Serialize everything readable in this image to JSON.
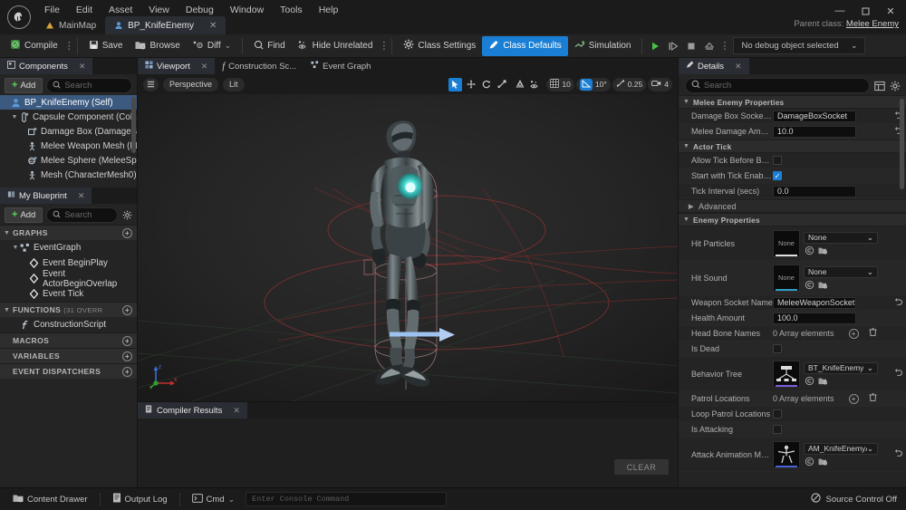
{
  "window": {
    "logo": "unreal-logo",
    "menus": [
      "File",
      "Edit",
      "Asset",
      "View",
      "Debug",
      "Window",
      "Tools",
      "Help"
    ],
    "controls": {
      "minimize": "—",
      "maximize": "❐",
      "close": "✕"
    },
    "parent_class_label": "Parent class:",
    "parent_class_value": "Melee Enemy"
  },
  "document_tabs": [
    {
      "label": "MainMap",
      "icon": "level-icon",
      "active": false,
      "closeable": false
    },
    {
      "label": "BP_KnifeEnemy",
      "icon": "blueprint-icon",
      "active": true,
      "closeable": true,
      "close": "✕"
    }
  ],
  "toolbar": {
    "compile": "Compile",
    "save": "Save",
    "browse": "Browse",
    "diff": "Diff",
    "find": "Find",
    "hide_unrelated": "Hide Unrelated",
    "class_settings": "Class Settings",
    "class_defaults": "Class Defaults",
    "simulation": "Simulation",
    "dots": "⋮",
    "chevron": "⌄",
    "play": "▶",
    "step": "⏯",
    "stop": "■",
    "eject": "⏏",
    "debug_object": "No debug object selected",
    "accent_color": "#1a7fd4"
  },
  "components_panel": {
    "tab": "Components",
    "tab_close": "✕",
    "add_label": "Add",
    "search_placeholder": "Search",
    "items": [
      {
        "label": "BP_KnifeEnemy (Self)",
        "indent": 0,
        "selected": true,
        "arrow": "",
        "icon": "actor-icon"
      },
      {
        "label": "Capsule Component (Collisi",
        "indent": 1,
        "selected": false,
        "arrow": "▼",
        "icon": "capsule-icon"
      },
      {
        "label": "Damage Box (DamageBox",
        "indent": 2,
        "selected": false,
        "arrow": "",
        "icon": "box-icon"
      },
      {
        "label": "Melee Weapon Mesh (Mel",
        "indent": 2,
        "selected": false,
        "arrow": "",
        "icon": "mesh-icon"
      },
      {
        "label": "Melee Sphere (MeleeSphe",
        "indent": 2,
        "selected": false,
        "arrow": "",
        "icon": "sphere-icon"
      },
      {
        "label": "Mesh (CharacterMesh0)",
        "indent": 2,
        "selected": false,
        "arrow": "",
        "icon": "mesh-icon"
      }
    ]
  },
  "my_blueprint_panel": {
    "tab": "My Blueprint",
    "tab_close": "✕",
    "add_label": "Add",
    "search_placeholder": "Search",
    "settings_icon": "gear-icon",
    "sections": [
      {
        "title": "GRAPHS",
        "suffix": "",
        "arrow": "▼",
        "plus": "+",
        "items": [
          {
            "label": "EventGraph",
            "indent": 1,
            "arrow": "▼",
            "icon": "graph-icon"
          },
          {
            "label": "Event BeginPlay",
            "indent": 2,
            "arrow": "",
            "icon": "event-node-icon"
          },
          {
            "label": "Event ActorBeginOverlap",
            "indent": 2,
            "arrow": "",
            "icon": "event-node-icon"
          },
          {
            "label": "Event Tick",
            "indent": 2,
            "arrow": "",
            "icon": "event-node-icon"
          }
        ]
      },
      {
        "title": "FUNCTIONS",
        "suffix": "(31 OVERR",
        "arrow": "▼",
        "plus": "+",
        "items": [
          {
            "label": "ConstructionScript",
            "indent": 1,
            "arrow": "",
            "icon": "function-icon"
          }
        ]
      },
      {
        "title": "MACROS",
        "suffix": "",
        "arrow": "",
        "plus": "+",
        "items": []
      },
      {
        "title": "VARIABLES",
        "suffix": "",
        "arrow": "",
        "plus": "+",
        "items": []
      },
      {
        "title": "EVENT DISPATCHERS",
        "suffix": "",
        "arrow": "",
        "plus": "+",
        "items": []
      }
    ]
  },
  "viewport_panel": {
    "tabs": [
      {
        "label": "Viewport",
        "active": true,
        "icon": "viewport-icon",
        "close": "✕"
      },
      {
        "label": "Construction Sc...",
        "active": false,
        "icon": "function-icon",
        "close": ""
      },
      {
        "label": "Event Graph",
        "active": false,
        "icon": "graph-icon",
        "close": ""
      }
    ],
    "menu_icon": "hamburger-icon",
    "camera_mode": "Perspective",
    "view_mode": "Lit",
    "transform_tools": [
      {
        "name": "select-tool",
        "glyph": "➤",
        "active": true
      },
      {
        "name": "move-tool",
        "glyph": "✥",
        "active": false
      },
      {
        "name": "rotate-tool",
        "glyph": "↻",
        "active": false
      },
      {
        "name": "scale-tool",
        "glyph": "⤡",
        "active": false
      }
    ],
    "space_tools": [
      {
        "name": "world-space-icon",
        "glyph": "△",
        "active": false
      },
      {
        "name": "surface-snap-icon",
        "glyph": "⁂",
        "active": false
      }
    ],
    "grid_snap": {
      "icon": "grid-icon",
      "value": "10"
    },
    "angle_snap": {
      "icon": "angle-icon",
      "value": "10°",
      "active": true
    },
    "scale_snap": {
      "icon": "scale-snap-icon",
      "value": "0.25"
    },
    "camera_speed": {
      "icon": "camera-icon",
      "value": "4"
    },
    "gizmo_axes": [
      "X",
      "Y",
      "Z"
    ]
  },
  "compiler_panel": {
    "tab": "Compiler Results",
    "tab_close": "✕",
    "icon": "log-icon",
    "clear_label": "CLEAR",
    "messages": []
  },
  "details_panel": {
    "tab": "Details",
    "tab_close": "✕",
    "icon": "details-icon",
    "search_placeholder": "Search",
    "grid_view_icon": "grid-view-icon",
    "settings_icon": "gear-icon",
    "sections": [
      {
        "title": "Melee Enemy Properties",
        "arrow": "▼",
        "rows": [
          {
            "type": "text",
            "label": "Damage Box Socket Name",
            "value": "DamageBoxSocket",
            "revert": true
          },
          {
            "type": "text",
            "label": "Melee Damage Amount",
            "value": "10.0",
            "revert": true
          }
        ]
      },
      {
        "title": "Actor Tick",
        "arrow": "▼",
        "rows": [
          {
            "type": "checkbox",
            "label": "Allow Tick Before Begin...",
            "checked": false
          },
          {
            "type": "checkbox",
            "label": "Start with Tick Enabled",
            "checked": true,
            "check": "✓"
          },
          {
            "type": "text",
            "label": "Tick Interval (secs)",
            "value": "0.0",
            "revert": false
          },
          {
            "type": "subsection",
            "label": "Advanced",
            "arrow": "▶"
          }
        ]
      },
      {
        "title": "Enemy Properties",
        "arrow": "▼",
        "rows": [
          {
            "type": "asset",
            "label": "Hit Particles",
            "thumb": "None",
            "value": "None",
            "underline": "#e0e0e0",
            "chevron": "⌄"
          },
          {
            "type": "asset",
            "label": "Hit Sound",
            "thumb": "None",
            "value": "None",
            "underline": "#2f9ec4",
            "chevron": "⌄"
          },
          {
            "type": "text",
            "label": "Weapon Socket Name",
            "value": "MeleeWeaponSocket",
            "revert": true
          },
          {
            "type": "text",
            "label": "Health Amount",
            "value": "100.0",
            "revert": false
          },
          {
            "type": "array",
            "label": "Head Bone Names",
            "value": "0 Array elements",
            "add": "+",
            "trash": "trash-icon"
          },
          {
            "type": "checkbox",
            "label": "Is Dead",
            "checked": false
          },
          {
            "type": "asset",
            "label": "Behavior Tree",
            "thumb": "behavior-tree-thumb",
            "value": "BT_KnifeEnemy",
            "underline": "#7b5ed6",
            "chevron": "⌄",
            "revert": true
          },
          {
            "type": "array",
            "label": "Patrol Locations",
            "value": "0 Array elements",
            "add": "+",
            "trash": "trash-icon"
          },
          {
            "type": "checkbox",
            "label": "Loop Patrol Locations",
            "checked": false
          },
          {
            "type": "checkbox",
            "label": "Is Attacking",
            "checked": false
          },
          {
            "type": "asset",
            "label": "Attack Animation Montage",
            "thumb": "anim-montage-thumb",
            "value": "AM_KnifeEnemyAtta",
            "underline": "#4a5fd6",
            "chevron": "⌄",
            "revert": true
          }
        ]
      }
    ]
  },
  "status_bar": {
    "content_drawer": "Content Drawer",
    "output_log": "Output Log",
    "cmd_label": "Cmd",
    "cmd_chevron": "⌄",
    "console_placeholder": "Enter Console Command",
    "source_control": "Source Control Off",
    "source_control_icon": "no-entry-icon"
  }
}
